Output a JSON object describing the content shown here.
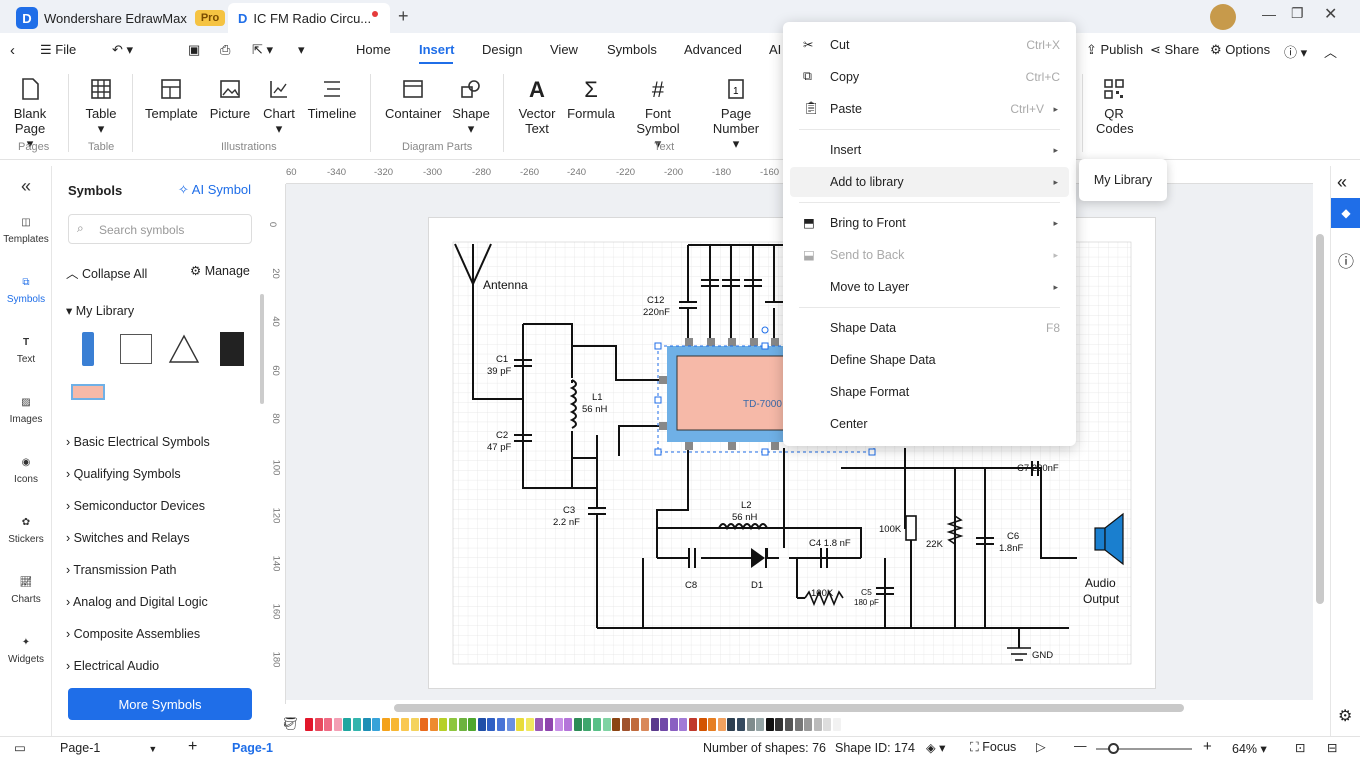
{
  "titlebar": {
    "app_name": "Wondershare EdrawMax",
    "pro_badge": "Pro",
    "doc_tab": "IC FM Radio Circu..."
  },
  "menubar": {
    "file": "File",
    "tabs": [
      "Home",
      "Insert",
      "Design",
      "View",
      "Symbols",
      "Advanced",
      "AI"
    ],
    "publish": "Publish",
    "share": "Share",
    "options": "Options"
  },
  "ribbon": {
    "buttons": {
      "blank_page": "Blank Page",
      "table": "Table",
      "template": "Template",
      "picture": "Picture",
      "chart": "Chart",
      "timeline": "Timeline",
      "container": "Container",
      "shape": "Shape",
      "vector_text": "Vector Text",
      "formula": "Formula",
      "font_symbol": "Font Symbol",
      "page_number": "Page Number",
      "qr_codes": "QR Codes"
    },
    "groups": {
      "pages": "Pages",
      "table": "Table",
      "illustrations": "Illustrations",
      "diagram_parts": "Diagram Parts",
      "text": "Text"
    }
  },
  "leftnav": {
    "items": [
      "Templates",
      "Symbols",
      "Text",
      "Images",
      "Icons",
      "Stickers",
      "Charts",
      "Widgets"
    ]
  },
  "symbols_panel": {
    "title": "Symbols",
    "ai_symbol": "AI Symbol",
    "search_placeholder": "Search symbols",
    "collapse_all": "Collapse All",
    "manage": "Manage",
    "my_library": "My Library",
    "categories": [
      "Basic Electrical Symbols",
      "Qualifying Symbols",
      "Semiconductor Devices",
      "Switches and Relays",
      "Transmission Path",
      "Analog and Digital Logic",
      "Composite Assemblies",
      "Electrical Audio"
    ],
    "more_symbols": "More Symbols"
  },
  "ruler": {
    "h_ticks": [
      "60",
      "-340",
      "-320",
      "-300",
      "-280",
      "-260",
      "-240",
      "-220",
      "-200",
      "-180",
      "-160"
    ],
    "v_ticks": [
      "0",
      "20",
      "40",
      "60",
      "80",
      "100",
      "120",
      "140",
      "160",
      "180"
    ]
  },
  "circuit": {
    "antenna": "Antenna",
    "c12": "C12",
    "c12_val": "220nF",
    "c1": "C1",
    "c1_val": "39 pF",
    "l1": "L1",
    "l1_val": "56 nH",
    "c2": "C2",
    "c2_val": "47 pF",
    "c3": "C3",
    "c3_val": "2.2 nF",
    "ic": "TD-7000",
    "l2": "L2",
    "l2_val": "56 nH",
    "c4": "C4 1.8 nF",
    "c8": "C8",
    "d1": "D1",
    "r100k_a": "100K",
    "c5": "C5",
    "c5_val": "180 pF",
    "r100k_b": "100K",
    "r22k": "22K",
    "c6": "C6",
    "c6_val": "1.8nF",
    "c7": "C7 220nF",
    "audio_output_1": "Audio",
    "audio_output_2": "Output",
    "gnd": "GND"
  },
  "context_menu": {
    "cut": "Cut",
    "cut_sc": "Ctrl+X",
    "copy": "Copy",
    "copy_sc": "Ctrl+C",
    "paste": "Paste",
    "paste_sc": "Ctrl+V",
    "insert": "Insert",
    "add_to_library": "Add to library",
    "bring_to_front": "Bring to Front",
    "send_to_back": "Send to Back",
    "move_to_layer": "Move to Layer",
    "shape_data": "Shape Data",
    "shape_data_sc": "F8",
    "define_shape_data": "Define Shape Data",
    "shape_format": "Shape Format",
    "center": "Center"
  },
  "submenu": {
    "my_library": "My Library"
  },
  "statusbar": {
    "page_select": "Page-1",
    "page_tab": "Page-1",
    "num_shapes": "Number of shapes: 76",
    "shape_id": "Shape ID: 174",
    "focus": "Focus",
    "zoom": "64%"
  },
  "colors": {
    "accent": "#1f6ee8",
    "ic_fill": "#f6b9a8",
    "ic_border": "#6fb0e6"
  }
}
